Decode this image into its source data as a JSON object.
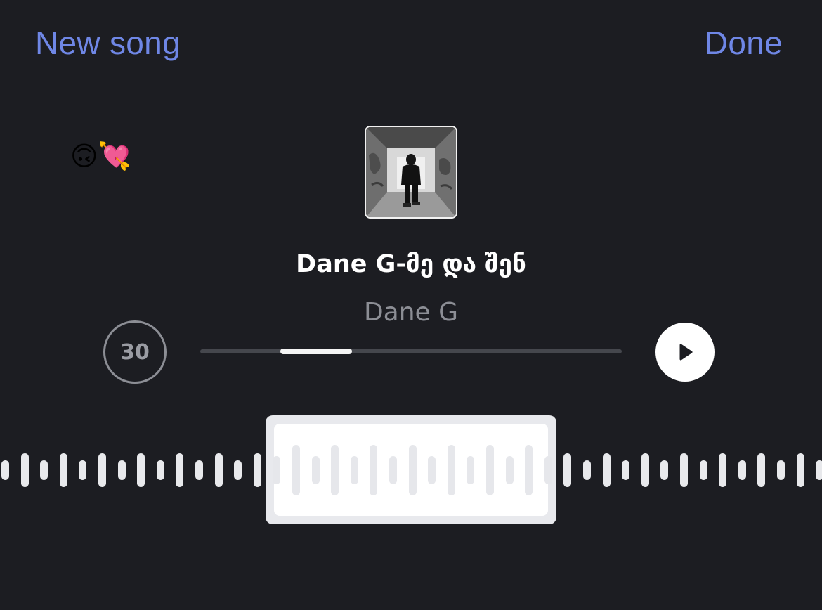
{
  "header": {
    "new_song_label": "New song",
    "done_label": "Done"
  },
  "caption": {
    "text": "🙃💘"
  },
  "song": {
    "title": "Dane G-მე და შენ",
    "artist": "Dane G"
  },
  "player": {
    "duration_label": "30",
    "progress_start": 0.19,
    "progress_end": 0.36
  },
  "colors": {
    "accent": "#6f87e6",
    "background": "#1c1d22"
  },
  "icons": {
    "play": "play-icon"
  }
}
